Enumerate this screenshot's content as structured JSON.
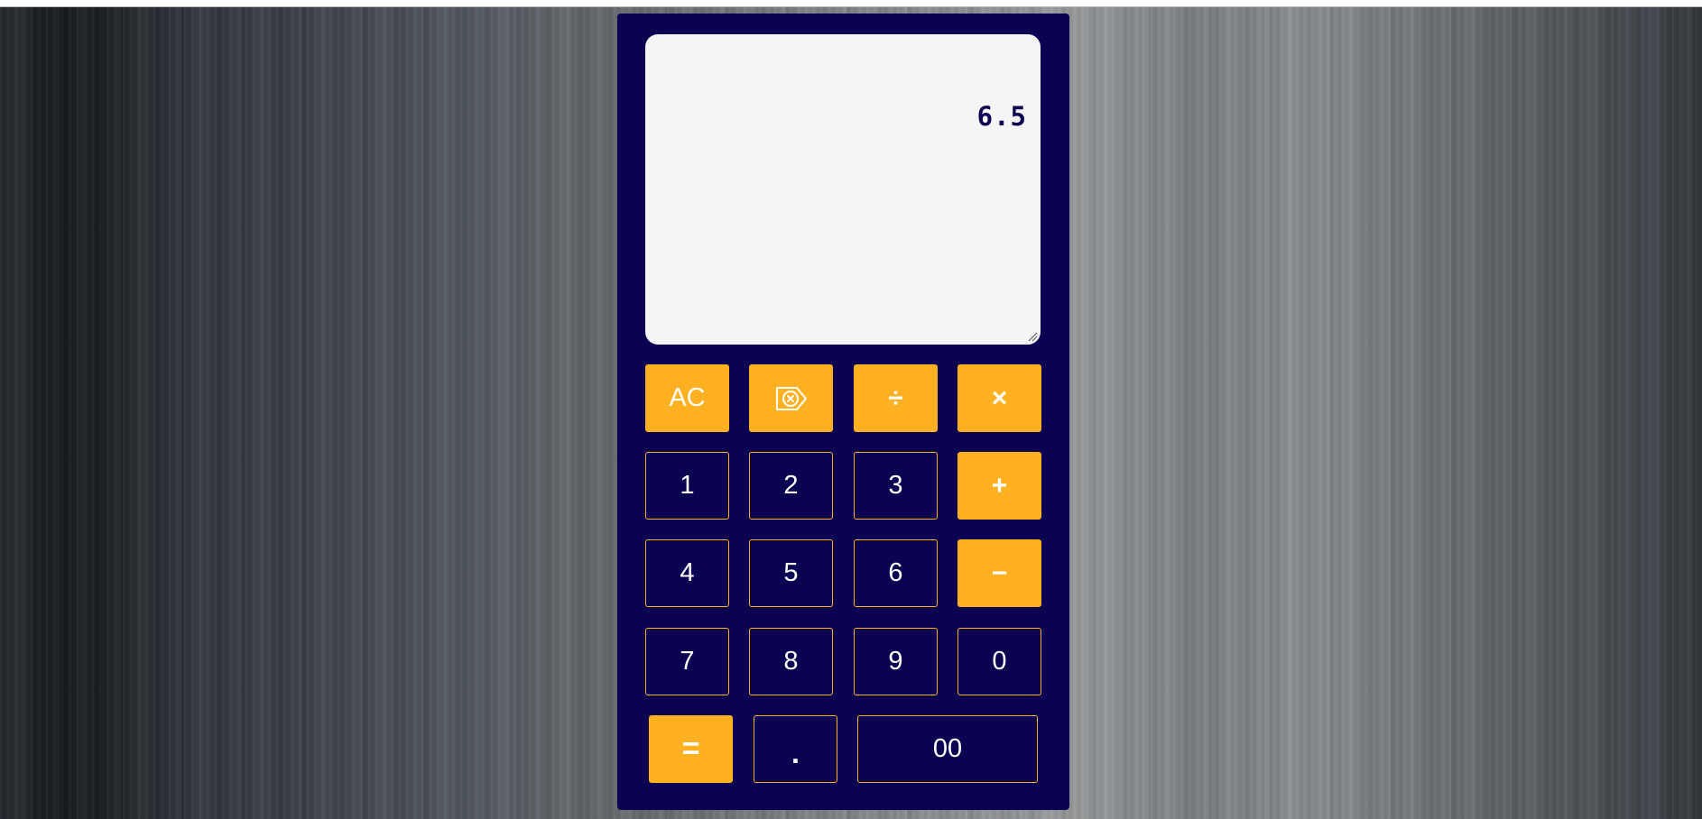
{
  "display": {
    "value": "6.5"
  },
  "keys": {
    "clear": "AC",
    "backspace_icon": "backspace-icon",
    "divide": "÷",
    "multiply": "×",
    "plus": "+",
    "minus": "−",
    "equals": "=",
    "decimal": ".",
    "double_zero": "00",
    "digits": {
      "d1": "1",
      "d2": "2",
      "d3": "3",
      "d4": "4",
      "d5": "5",
      "d6": "6",
      "d7": "7",
      "d8": "8",
      "d9": "9",
      "d0": "0"
    }
  },
  "colors": {
    "body": "#0b0252",
    "accent": "#ffb122",
    "display_bg": "#f5f5f5",
    "display_text": "#0b0252"
  }
}
